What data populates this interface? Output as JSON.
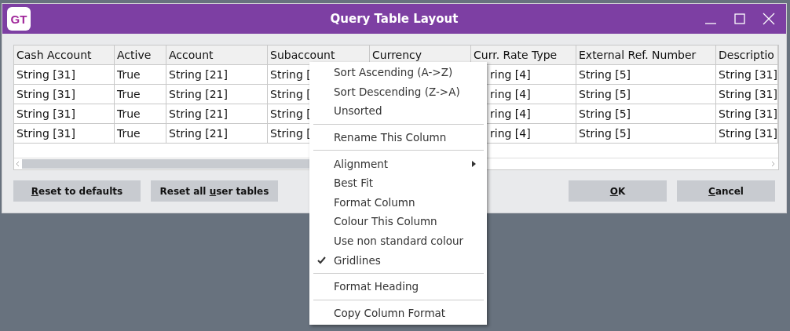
{
  "window": {
    "logo": "GT",
    "title": "Query Table Layout"
  },
  "table": {
    "columns": [
      "Cash Account",
      "Active",
      "Account",
      "Subaccount",
      "Currency",
      "Curr. Rate Type",
      "External Ref. Number",
      "Descriptio"
    ],
    "rows": [
      {
        "cells": [
          "String [31]",
          "True",
          "String [21]",
          "String [",
          null,
          "ring [4]",
          "String [5]",
          "String [31]"
        ]
      },
      {
        "cells": [
          "String [31]",
          "True",
          "String [21]",
          "String [",
          null,
          "ring [4]",
          "String [5]",
          "String [31]"
        ]
      },
      {
        "cells": [
          "String [31]",
          "True",
          "String [21]",
          "String [",
          null,
          "ring [4]",
          "String [5]",
          "String [31]"
        ]
      },
      {
        "cells": [
          "String [31]",
          "True",
          "String [21]",
          "String [",
          null,
          "ring [4]",
          "String [5]",
          "String [31]"
        ]
      }
    ]
  },
  "left_buttons": [
    {
      "mnemonic": "R",
      "after": "eset to defaults"
    },
    {
      "before": "Reset all ",
      "mnemonic": "u",
      "after": "ser tables"
    }
  ],
  "right_buttons": [
    {
      "mnemonic": "O",
      "after": "K"
    },
    {
      "mnemonic": "C",
      "after": "ancel"
    }
  ],
  "context_menu": [
    {
      "kind": "item",
      "label": "Sort Ascending (A->Z)",
      "checked": false,
      "submenu": false
    },
    {
      "kind": "item",
      "label": "Sort Descending (Z->A)",
      "checked": false,
      "submenu": false
    },
    {
      "kind": "item",
      "label": "Unsorted",
      "checked": false,
      "submenu": false
    },
    {
      "kind": "separator"
    },
    {
      "kind": "item",
      "label": "Rename This Column",
      "checked": false,
      "submenu": false
    },
    {
      "kind": "separator"
    },
    {
      "kind": "item",
      "label": "Alignment",
      "checked": false,
      "submenu": true
    },
    {
      "kind": "item",
      "label": "Best Fit",
      "checked": false,
      "submenu": false
    },
    {
      "kind": "item",
      "label": "Format Column",
      "checked": false,
      "submenu": false
    },
    {
      "kind": "item",
      "label": "Colour This Column",
      "checked": false,
      "submenu": false
    },
    {
      "kind": "item",
      "label": "Use non standard colour",
      "checked": false,
      "submenu": false
    },
    {
      "kind": "item",
      "label": "Gridlines",
      "checked": true,
      "submenu": false
    },
    {
      "kind": "separator"
    },
    {
      "kind": "item",
      "label": "Format Heading",
      "checked": false,
      "submenu": false
    },
    {
      "kind": "separator"
    },
    {
      "kind": "item",
      "label": "Copy Column Format",
      "checked": false,
      "submenu": false
    }
  ]
}
